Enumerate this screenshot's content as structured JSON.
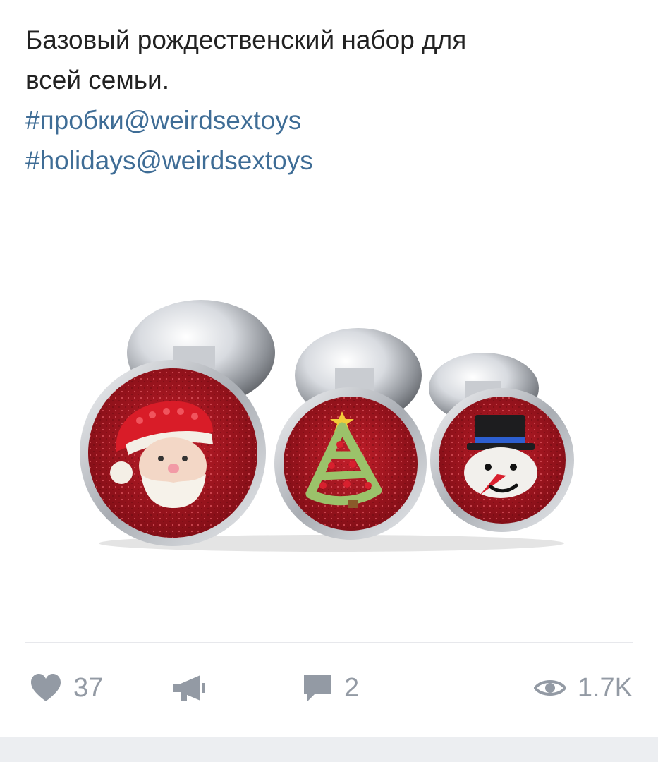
{
  "post": {
    "text_line1": "Базовый рождественский набор для",
    "text_line2": "всей семьи.",
    "hashtags": [
      "#пробки@weirdsextoys",
      "#holidays@weirdsextoys"
    ]
  },
  "actions": {
    "likes": "37",
    "comments": "2",
    "views": "1.7K"
  },
  "colors": {
    "hashtag": "#3f6d96",
    "icon": "#939aa4",
    "glitter_red": "#a8141e"
  },
  "icons": [
    "heart-icon",
    "megaphone-icon",
    "comment-icon",
    "eye-icon"
  ]
}
